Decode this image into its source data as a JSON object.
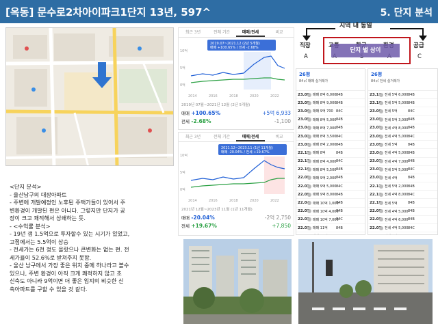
{
  "header": {
    "title": "[옥동] 문수로2차아이파크1단지 13년, 597^",
    "section": "5. 단지 분석"
  },
  "analysis": {
    "lines": [
      "<단지 분석>",
      "-  울산남구의 대장아파트",
      "-  주변에 개발예정인 노후된 주택가들이 있어서 주",
      "   변환경이 개발된 편은 아니다. 그렇지만 단지가 공",
      "   장이 크고 쾌적해서 상쇄하는 듯.",
      "",
      "-  <수익률 분석>",
      "-  19년 갭 1.5억으로 투자할수 있는 시기가 있었고,",
      "   고점에서는 5.5억이 상승",
      "-  전세가는 6천 정도 올랐으나 큰변화는 없는 편. 전",
      "   세가율이 52.6%로 받쳐주지 못함.",
      "-  울산 남구에서 가장 좋은 위치 중에 하나라고 볼수",
      "   있으나, 주변 환경이 아직 크게 쾌적하지 않고 초",
      "   신축도 아니라 9억이면 더 좋은 입지의 비슷한 신",
      "   축아파트를 구할 수 있을 것 같다."
    ]
  },
  "chart1": {
    "tabs": [
      "최근 3년",
      "전체 기간",
      "매매/전세",
      "비교"
    ],
    "tooltip_line1": "2019.07~2021.12 (2년 5개월)",
    "tooltip_line2": "매매 +100.65% / 전세 -2.68%",
    "period": "2019년 07월~2021년 12월 (2년 5개월)",
    "sale_label": "매매",
    "sale_pct": "+100.65%",
    "sale_amt": "+5억 6,933",
    "jeonse_label": "전세",
    "jeonse_pct": "-2.68%",
    "jeonse_amt": "-1,100",
    "y_ticks": [
      "10억",
      "5억",
      "0억"
    ],
    "x_ticks": [
      "2014",
      "2016",
      "2018",
      "2020",
      "2022"
    ]
  },
  "chart2": {
    "tabs": [
      "최근 3년",
      "전체 기간",
      "매매/전세",
      "비교"
    ],
    "tooltip_line1": "2021.12~2023.11 (1년 11개월)",
    "tooltip_line2": "매매 -20.04% / 전세 +19.67%",
    "period": "2021년 12월~2023년 11월 (1년 11개월)",
    "sale_label": "매매",
    "sale_pct": "-20.04%",
    "sale_amt": "-2억 2,750",
    "jeonse_label": "전세",
    "jeonse_pct": "+19.67%",
    "jeonse_amt": "+7,850",
    "y_ticks": [
      "10억",
      "5억",
      "0억"
    ],
    "x_ticks": [
      "2014",
      "2016",
      "2018",
      "2020",
      "2022"
    ]
  },
  "comparison": {
    "title": "지역 내 동일",
    "row1": [
      "직장",
      "교통",
      "학군",
      "환경",
      "공급"
    ],
    "row2": [
      "A",
      "A",
      "S",
      "A",
      "C"
    ],
    "overlay": "단지 별 상이"
  },
  "tx_left": {
    "area": "26평",
    "subtitle": "84㎡ 매매 실거래가",
    "rows": [
      {
        "date": "23.09",
        "desc": "매매 8억 6,000",
        "type": "84B"
      },
      {
        "date": "23.08",
        "desc": "매매 8억 9,000",
        "type": "84B"
      },
      {
        "date": "23.06",
        "desc": "매매 9억 700",
        "type": "84C"
      },
      {
        "date": "23.05",
        "desc": "매매 8억 5,000",
        "type": "84B"
      },
      {
        "date": "23.04",
        "desc": "매매 8억 7,000",
        "type": "84B"
      },
      {
        "date": "23.02",
        "desc": "매매 8억 3,500",
        "type": "84C"
      },
      {
        "date": "23.01",
        "desc": "매매 8억 2,000",
        "type": "84B"
      },
      {
        "date": "22.12",
        "desc": "매매 8억",
        "type": "84B"
      },
      {
        "date": "22.11",
        "desc": "매매 8억 4,000",
        "type": "84C"
      },
      {
        "date": "22.10",
        "desc": "매매 8억 5,500",
        "type": "84B"
      },
      {
        "date": "22.08",
        "desc": "매매 9억 2,000",
        "type": "84B"
      },
      {
        "date": "22.07",
        "desc": "매매 9억 5,000",
        "type": "84C"
      },
      {
        "date": "22.05",
        "desc": "매매 9억 8,000",
        "type": "84B"
      },
      {
        "date": "22.04",
        "desc": "매매 10억 1,000",
        "type": "84B"
      },
      {
        "date": "22.03",
        "desc": "매매 10억 4,000",
        "type": "84B"
      },
      {
        "date": "22.02",
        "desc": "매매 10억 7,000",
        "type": "84C"
      },
      {
        "date": "22.01",
        "desc": "매매 11억",
        "type": "84B"
      },
      {
        "date": "21.12",
        "desc": "매매 11억 3,500",
        "type": "84B"
      }
    ]
  },
  "tx_right": {
    "area": "26평",
    "subtitle": "84㎡ 전세 실거래가",
    "rows": [
      {
        "date": "23.11",
        "desc": "전세 5억 6,000",
        "type": "84B"
      },
      {
        "date": "23.10",
        "desc": "전세 5억 5,000",
        "type": "84B"
      },
      {
        "date": "23.09",
        "desc": "전세 5억",
        "type": "84C"
      },
      {
        "date": "23.08",
        "desc": "전세 5억 3,000",
        "type": "84B"
      },
      {
        "date": "23.07",
        "desc": "전세 4억 8,000",
        "type": "84B"
      },
      {
        "date": "23.06",
        "desc": "전세 4억 5,000",
        "type": "84C"
      },
      {
        "date": "23.05",
        "desc": "전세 5억",
        "type": "84B"
      },
      {
        "date": "23.04",
        "desc": "전세 4억 5,000",
        "type": "84B"
      },
      {
        "date": "23.03",
        "desc": "전세 4억 7,000",
        "type": "84B"
      },
      {
        "date": "23.02",
        "desc": "전세 5억 5,000",
        "type": "84C"
      },
      {
        "date": "23.01",
        "desc": "전세 4억",
        "type": "84B"
      },
      {
        "date": "22.12",
        "desc": "전세 5억 2,000",
        "type": "84B"
      },
      {
        "date": "22.11",
        "desc": "전세 4억 8,000",
        "type": "84C"
      },
      {
        "date": "22.10",
        "desc": "전세 5억",
        "type": "84B"
      },
      {
        "date": "22.09",
        "desc": "전세 4억 5,000",
        "type": "84B"
      },
      {
        "date": "22.08",
        "desc": "전세 4억 6,000",
        "type": "84B"
      },
      {
        "date": "22.07",
        "desc": "전세 4억 5,000",
        "type": "84C"
      },
      {
        "date": "22.06",
        "desc": "전세 4억 8,000",
        "type": "84B"
      }
    ]
  },
  "colors": {
    "header_bg": "#2e6da4",
    "sale": "#1f5fd6",
    "jeonse": "#2aa043",
    "highlight": "#c0151b"
  }
}
